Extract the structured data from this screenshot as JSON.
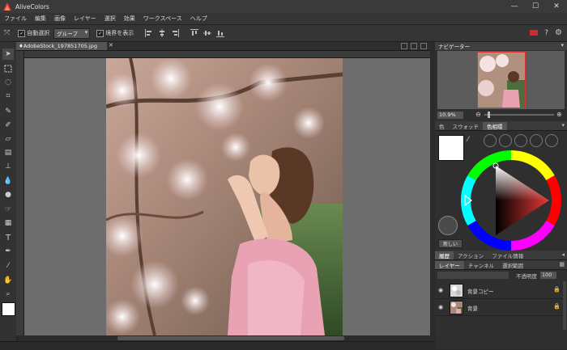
{
  "app": {
    "title": "AliveColors"
  },
  "window": {
    "minimize": "—",
    "maximize": "☐",
    "close": "✕"
  },
  "menu": [
    "ファイル",
    "編集",
    "画像",
    "レイヤー",
    "選択",
    "効果",
    "ワークスペース",
    "ヘルプ"
  ],
  "options": {
    "auto_select_label": "自動選択",
    "group_value": "グループ",
    "show_bounds_label": "境界を表示",
    "help_glyph": "?"
  },
  "document": {
    "tab_title": "♦AdobeStock_197851705.jpg",
    "close": "✕"
  },
  "navigator": {
    "title": "ナビゲーター",
    "zoom": "10.9%"
  },
  "color_panel": {
    "tabs": [
      "色",
      "スウォッチ",
      "色相環"
    ],
    "new_button": "新しい",
    "accent": "#d8262e"
  },
  "history_tabs": [
    "履歴",
    "アクション",
    "ファイル情報"
  ],
  "layers_panel": {
    "tabs": [
      "レイヤー",
      "チャンネル",
      "選択範囲"
    ],
    "opacity_label": "不透明度",
    "opacity_value": "100",
    "layers": [
      {
        "name": "背景コピー"
      },
      {
        "name": "背景"
      }
    ]
  }
}
